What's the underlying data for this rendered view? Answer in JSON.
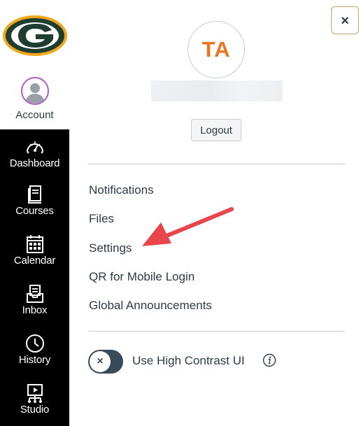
{
  "nav": {
    "account_label": "Account",
    "items": [
      {
        "label": "Dashboard",
        "icon": "dashboard-icon"
      },
      {
        "label": "Courses",
        "icon": "courses-icon"
      },
      {
        "label": "Calendar",
        "icon": "calendar-icon"
      },
      {
        "label": "Inbox",
        "icon": "inbox-icon"
      },
      {
        "label": "History",
        "icon": "history-icon"
      },
      {
        "label": "Studio",
        "icon": "studio-icon"
      }
    ]
  },
  "tray": {
    "close_label": "×",
    "avatar_initials": "TA",
    "logout_label": "Logout",
    "links": [
      "Notifications",
      "Files",
      "Settings",
      "QR for Mobile Login",
      "Global Announcements"
    ],
    "high_contrast": {
      "label": "Use High Contrast UI",
      "enabled": false,
      "knob_symbol": "×"
    }
  },
  "colors": {
    "nav_background": "#000000",
    "avatar_initials": "#ee7320",
    "arrow": "#e8464b",
    "logo_green": "#1f3e2f",
    "logo_gold": "#f0a81c",
    "toggle": "#394b58"
  }
}
